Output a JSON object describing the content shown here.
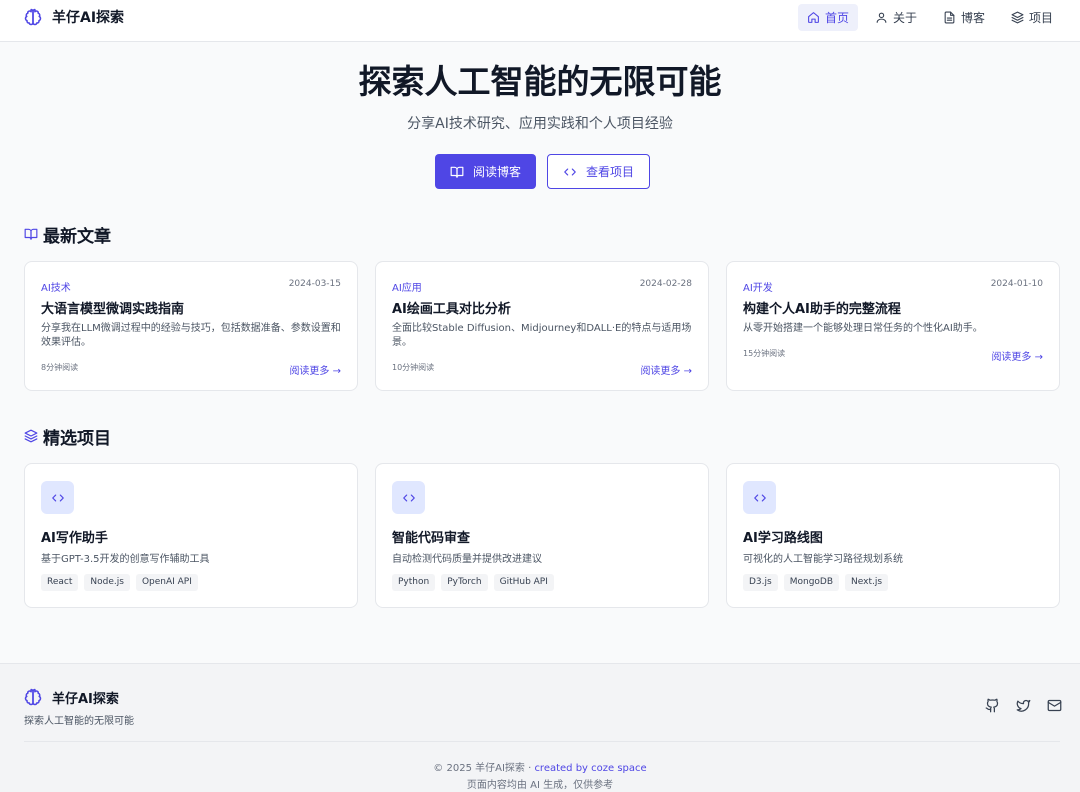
{
  "header": {
    "brand": "羊仔AI探索",
    "logo_icon": "brain-icon",
    "nav": [
      {
        "label": "首页",
        "icon": "home-icon",
        "active": true
      },
      {
        "label": "关于",
        "icon": "user-icon",
        "active": false
      },
      {
        "label": "博客",
        "icon": "document-icon",
        "active": false
      },
      {
        "label": "项目",
        "icon": "layers-icon",
        "active": false
      }
    ]
  },
  "hero": {
    "title": "探索人工智能的无限可能",
    "subtitle": "分享AI技术研究、应用实践和个人项目经验",
    "primary_button": "阅读博客",
    "secondary_button": "查看项目"
  },
  "articles": {
    "heading": "最新文章",
    "items": [
      {
        "category": "AI技术",
        "date": "2024-03-15",
        "title": "大语言模型微调实践指南",
        "desc": "分享我在LLM微调过程中的经验与技巧，包括数据准备、参数设置和效果评估。",
        "read_time": "8分钟阅读",
        "more": "阅读更多 →"
      },
      {
        "category": "AI应用",
        "date": "2024-02-28",
        "title": "AI绘画工具对比分析",
        "desc": "全面比较Stable Diffusion、Midjourney和DALL·E的特点与适用场景。",
        "read_time": "10分钟阅读",
        "more": "阅读更多 →"
      },
      {
        "category": "AI开发",
        "date": "2024-01-10",
        "title": "构建个人AI助手的完整流程",
        "desc": "从零开始搭建一个能够处理日常任务的个性化AI助手。",
        "read_time": "15分钟阅读",
        "more": "阅读更多 →"
      }
    ]
  },
  "projects": {
    "heading": "精选项目",
    "items": [
      {
        "title": "AI写作助手",
        "desc": "基于GPT-3.5开发的创意写作辅助工具",
        "tags": [
          "React",
          "Node.js",
          "OpenAI API"
        ]
      },
      {
        "title": "智能代码审查",
        "desc": "自动检测代码质量并提供改进建议",
        "tags": [
          "Python",
          "PyTorch",
          "GitHub API"
        ]
      },
      {
        "title": "AI学习路线图",
        "desc": "可视化的人工智能学习路径规划系统",
        "tags": [
          "D3.js",
          "MongoDB",
          "Next.js"
        ]
      }
    ]
  },
  "footer": {
    "brand": "羊仔AI探索",
    "tagline": "探索人工智能的无限可能",
    "social": [
      "github-icon",
      "twitter-icon",
      "mail-icon"
    ],
    "copyright": "© 2025 羊仔AI探索 · ",
    "credit": "created by coze space",
    "note": "页面内容均由 AI 生成，仅供参考"
  },
  "colors": {
    "accent": "#4f46e5",
    "accent_light": "#e0e7ff",
    "background": "#f9fafb",
    "text": "#111827"
  }
}
